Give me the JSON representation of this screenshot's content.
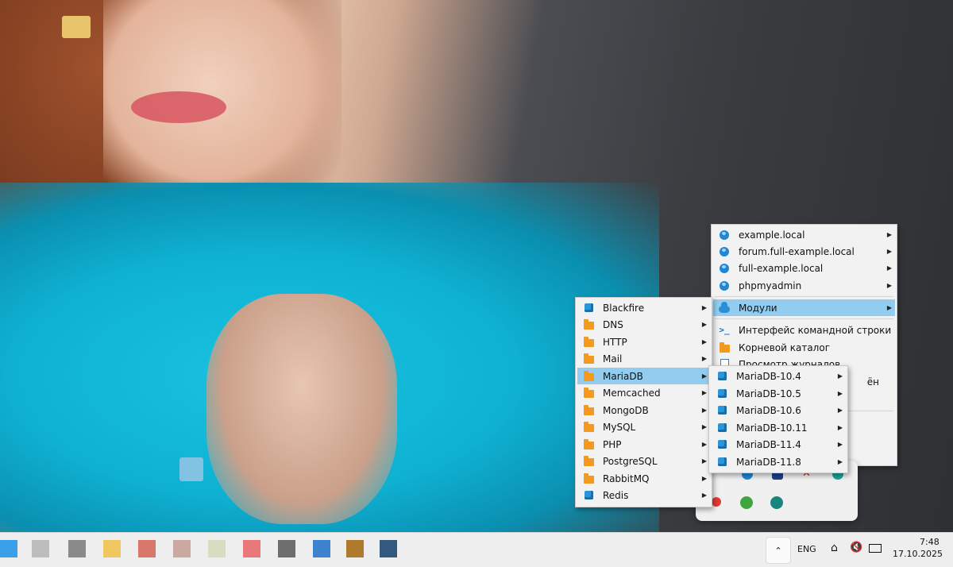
{
  "modules_menu": {
    "items": [
      {
        "label": "Blackfire",
        "icon": "cube-icon"
      },
      {
        "label": "DNS",
        "icon": "folder-icon"
      },
      {
        "label": "HTTP",
        "icon": "folder-icon"
      },
      {
        "label": "Mail",
        "icon": "folder-icon"
      },
      {
        "label": "MariaDB",
        "icon": "folder-icon",
        "highlighted": true
      },
      {
        "label": "Memcached",
        "icon": "folder-icon"
      },
      {
        "label": "MongoDB",
        "icon": "folder-icon"
      },
      {
        "label": "MySQL",
        "icon": "folder-icon"
      },
      {
        "label": "PHP",
        "icon": "folder-icon"
      },
      {
        "label": "PostgreSQL",
        "icon": "folder-icon"
      },
      {
        "label": "RabbitMQ",
        "icon": "folder-icon"
      },
      {
        "label": "Redis",
        "icon": "cube-icon"
      }
    ]
  },
  "main_menu": {
    "items": [
      {
        "label": "example.local",
        "icon": "globe-icon"
      },
      {
        "label": "forum.full-example.local",
        "icon": "globe-icon"
      },
      {
        "label": "full-example.local",
        "icon": "globe-icon"
      },
      {
        "label": "phpmyadmin",
        "icon": "globe-icon"
      },
      {
        "label": "Модули",
        "icon": "cloud-icon",
        "highlighted": true
      },
      {
        "label": "Интерфейс командной строки",
        "icon": "terminal-icon"
      },
      {
        "label": "Корневой каталог",
        "icon": "folder-icon"
      },
      {
        "label": "Просмотр журналов",
        "icon": "document-icon"
      },
      {
        "label": "ён",
        "icon": "none"
      }
    ]
  },
  "mariadb_menu": {
    "items": [
      {
        "label": "MariaDB-10.4"
      },
      {
        "label": "MariaDB-10.5"
      },
      {
        "label": "MariaDB-10.6"
      },
      {
        "label": "MariaDB-10.11"
      },
      {
        "label": "MariaDB-11.4"
      },
      {
        "label": "MariaDB-11.8"
      }
    ]
  },
  "taskbar": {
    "language": "ENG",
    "time": "7:48",
    "date": "17.10.2025",
    "tray_chevron": "chevron-up-icon"
  },
  "colors": {
    "highlight": "#92cdf0",
    "folder": "#f39a1e",
    "accent_blue": "#2b95d8"
  }
}
